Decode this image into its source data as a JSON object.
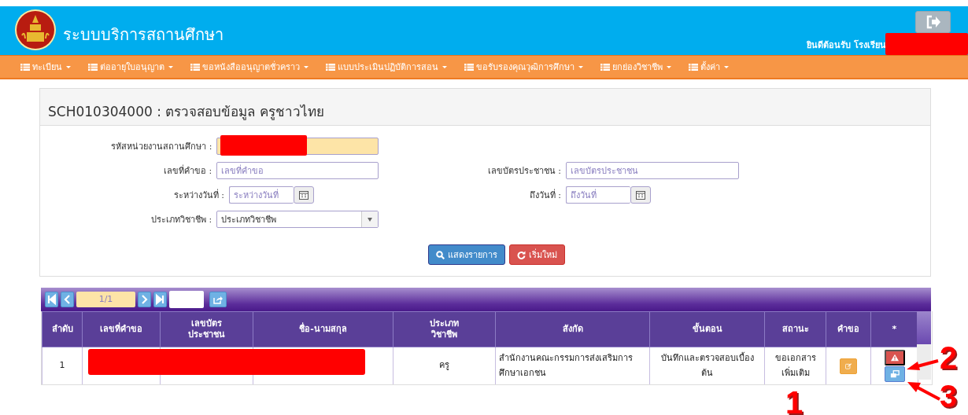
{
  "header": {
    "title": "ระบบบริการสถานศึกษา",
    "welcome": "ยินดีต้อนรับ โรงเรียน",
    "redacted": true
  },
  "menu": [
    {
      "label": "ทะเบียน"
    },
    {
      "label": "ต่ออายุใบอนุญาต"
    },
    {
      "label": "ขอหนังสืออนุญาตชั่วคราว"
    },
    {
      "label": "แบบประเมินปฏิบัติการสอน"
    },
    {
      "label": "ขอรับรองคุณวุฒิการศึกษา"
    },
    {
      "label": "ยกย่องวิชาชีพ"
    },
    {
      "label": "ตั้งค่า"
    }
  ],
  "page_title": "SCH010304000 : ตรวจสอบข้อมูล ครูชาวไทย",
  "form": {
    "rows": [
      [
        {
          "label": "รหัสหน่วยงานสถานศึกษา :",
          "kind": "redacted"
        }
      ],
      [
        {
          "label": "เลขที่คำขอ :",
          "kind": "text",
          "placeholder": "เลขที่คำขอ"
        },
        {
          "label": "เลขบัตรประชาชน :",
          "kind": "text",
          "placeholder": "เลขบัตรประชาชน"
        }
      ],
      [
        {
          "label": "ระหว่างวันที่ :",
          "kind": "date",
          "placeholder": "ระหว่างวันที่"
        },
        {
          "label": "ถึงวันที่ :",
          "kind": "date",
          "placeholder": "ถึงวันที่"
        }
      ],
      [
        {
          "label": "ประเภทวิชาชีพ :",
          "kind": "select",
          "value": "ประเภทวิชาชีพ"
        }
      ]
    ],
    "buttons": [
      {
        "label": "แสดงรายการ",
        "kind": "search"
      },
      {
        "label": "เริ่มใหม่",
        "kind": "reset"
      }
    ]
  },
  "pager": {
    "page": "1/1"
  },
  "table": {
    "columns": [
      "ลำดับ",
      "เลขที่คำขอ",
      "เลขบัตร\nประชาชน",
      "ชื่อ-นามสกุล",
      "ประเภท\nวิชาชีพ",
      "สังกัด",
      "ขั้นตอน",
      "สถานะ",
      "คำขอ",
      "*"
    ],
    "rows": [
      {
        "no": "1",
        "redacted": true,
        "profession": "ครู",
        "affiliation": "สำนักงานคณะกรรมการส่งเสริมการศึกษาเอกชน",
        "step": "บันทึกและตรวจสอบเบื้องต้น",
        "status": "ขอเอกสารเพิ่มเติม"
      }
    ]
  },
  "annotations": [
    {
      "label": "1"
    },
    {
      "label": "2"
    },
    {
      "label": "3"
    }
  ]
}
